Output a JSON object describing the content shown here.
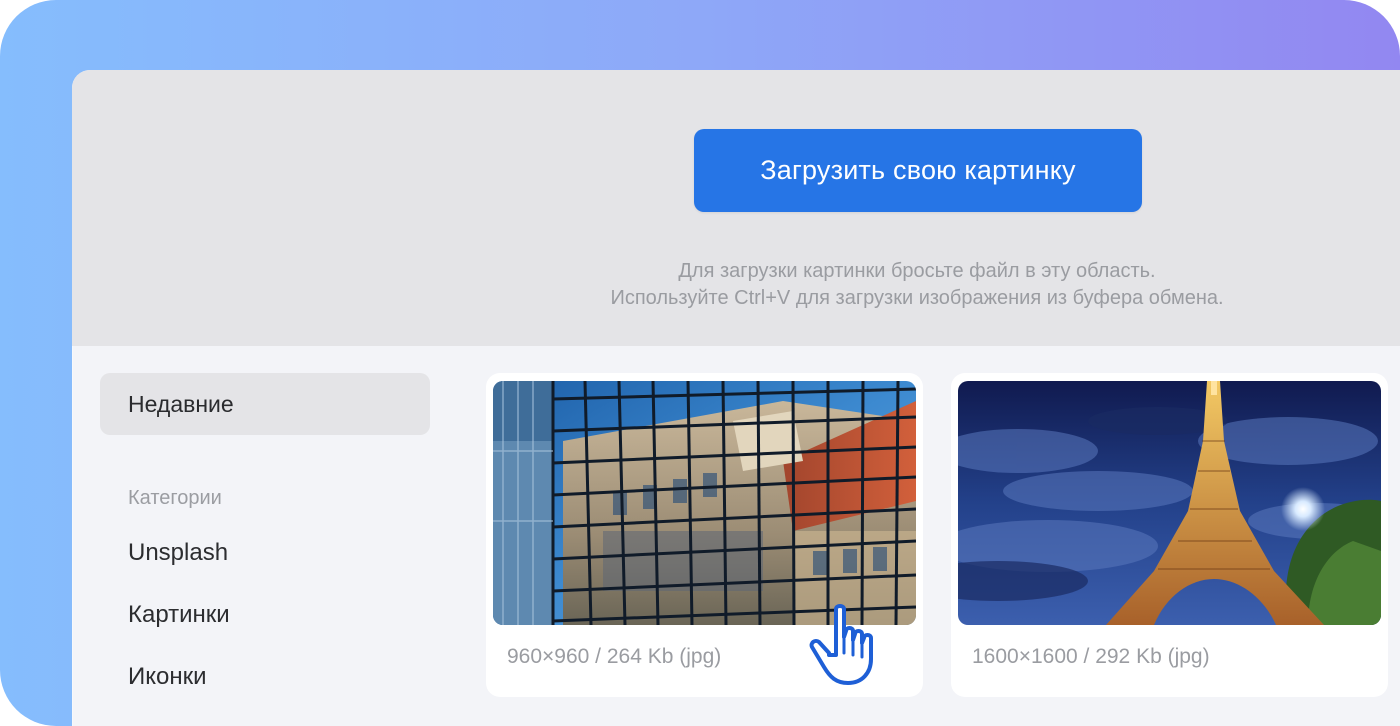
{
  "upload": {
    "button_label": "Загрузить свою картинку",
    "hint_line1": "Для загрузки картинки бросьте файл в эту область.",
    "hint_line2": "Используйте Ctrl+V для загрузки изображения из буфера обмена."
  },
  "sidebar": {
    "active_item": "Недавние",
    "categories_heading": "Категории",
    "items": [
      {
        "label": "Unsplash"
      },
      {
        "label": "Картинки"
      },
      {
        "label": "Иконки"
      }
    ]
  },
  "images": [
    {
      "caption": "960×960 / 264 Kb (jpg)",
      "icon": "glass-building-photo"
    },
    {
      "caption": "1600×1600 / 292 Kb (jpg)",
      "icon": "eiffel-tower-photo"
    }
  ],
  "colors": {
    "accent": "#2675e6",
    "frame_gradient_start": "#85bdfd",
    "frame_gradient_end": "#9287f1"
  },
  "pointer": {
    "icon": "hand-pointer-icon"
  }
}
